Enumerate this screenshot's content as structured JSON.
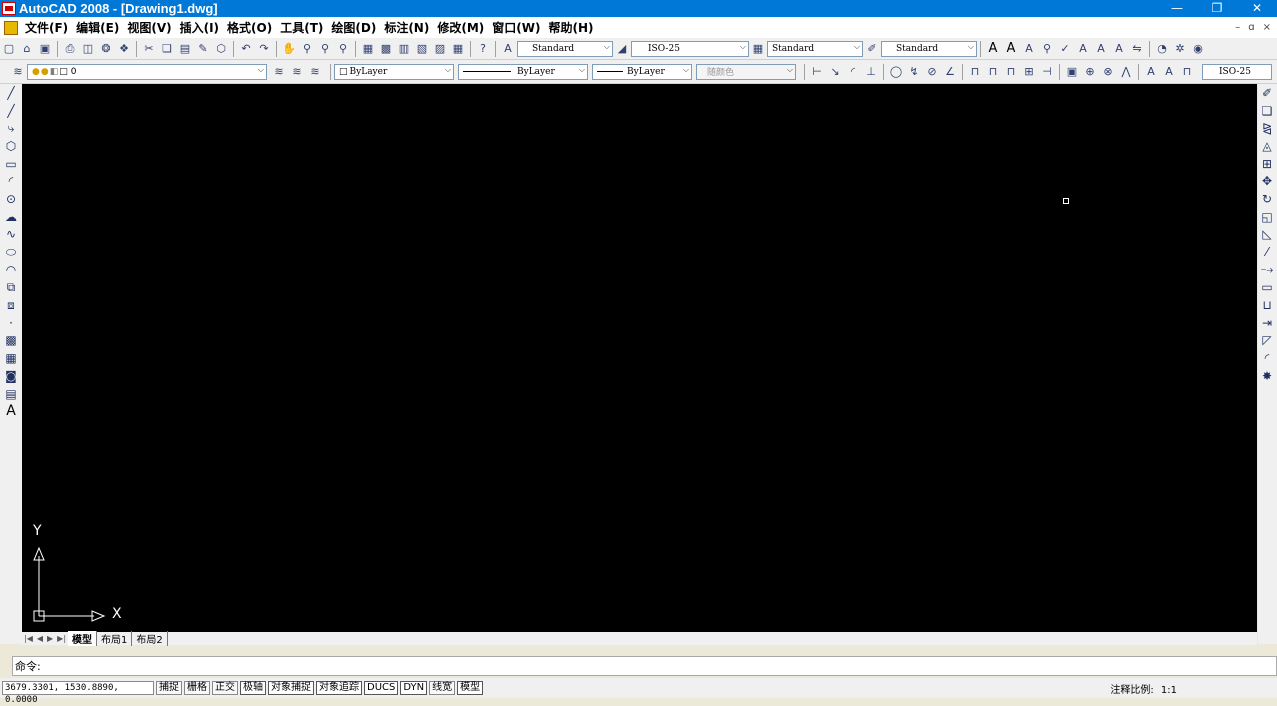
{
  "window": {
    "title": "AutoCAD 2008 - [Drawing1.dwg]",
    "buttons": [
      "—",
      "❐",
      "✕"
    ]
  },
  "menubar": {
    "items": [
      "文件(F)",
      "编辑(E)",
      "视图(V)",
      "插入(I)",
      "格式(O)",
      "工具(T)",
      "绘图(D)",
      "标注(N)",
      "修改(M)",
      "窗口(W)",
      "帮助(H)"
    ],
    "mdi_buttons": [
      "–",
      "ɑ",
      "×"
    ]
  },
  "toolbar1": {
    "text_style": "Standard",
    "dim_style": "ISO-25",
    "table_style": "Standard",
    "multileader_style": "Standard"
  },
  "toolbar2": {
    "layer": "0",
    "color": "ByLayer",
    "linetype": "ByLayer",
    "lineweight": "ByLayer",
    "plot_style": "随颜色",
    "dim_style_right": "ISO-25"
  },
  "ucs": {
    "x_label": "X",
    "y_label": "Y"
  },
  "layout_tabs": [
    "模型",
    "布局1",
    "布局2"
  ],
  "command_prompt": "命令:",
  "status": {
    "coords": "3679.3301, 1530.8890, 0.0000",
    "buttons": [
      "捕捉",
      "栅格",
      "正交",
      "极轴",
      "对象捕捉",
      "对象追踪",
      "DUCS",
      "DYN",
      "线宽",
      "模型"
    ],
    "annotation_scale_label": "注释比例:",
    "annotation_scale_value": "1:1"
  },
  "colors": {
    "titlebar": "#0078d7",
    "drawing_bg": "#000000"
  }
}
